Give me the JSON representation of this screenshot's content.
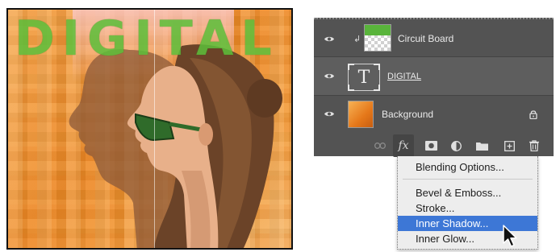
{
  "canvas": {
    "title_text": "DIGITAL"
  },
  "layers_panel": {
    "layers": [
      {
        "name": "Circuit Board",
        "visible": true,
        "clipped": true,
        "thumbnail": "circuit-board-thumbnail"
      },
      {
        "name": "DIGITAL",
        "visible": true,
        "type": "text-layer",
        "thumbnail": "type-T-thumbnail"
      },
      {
        "name": "Background",
        "visible": true,
        "locked": true,
        "thumbnail": "background-thumbnail"
      }
    ],
    "footer_icons": [
      "link-icon",
      "fx-icon",
      "mask-icon",
      "adjustment-icon",
      "folder-icon",
      "new-layer-icon",
      "trash-icon"
    ]
  },
  "fx_menu": {
    "items": [
      "Blending Options...",
      "Bevel & Emboss...",
      "Stroke...",
      "Inner Shadow...",
      "Inner Glow..."
    ],
    "highlighted": "Inner Shadow..."
  },
  "colors": {
    "panel_bg": "#535353",
    "selected_row": "#5e5e5e",
    "menu_highlight": "#3d77d6",
    "title_green": "#5cbf3a"
  }
}
